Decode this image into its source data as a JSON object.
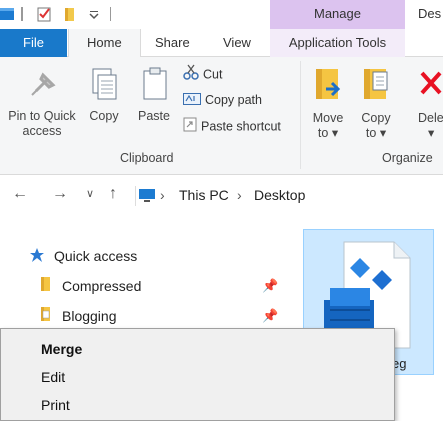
{
  "titlebar": {
    "manage_label": "Manage",
    "title_fragment": "Des"
  },
  "ribbon_tabs": {
    "file": "File",
    "home": "Home",
    "share": "Share",
    "view": "View",
    "application_tools": "Application Tools"
  },
  "clipboard": {
    "pin_label_1": "Pin to Quick",
    "pin_label_2": "access",
    "copy": "Copy",
    "paste": "Paste",
    "cut": "Cut",
    "copy_path": "Copy path",
    "paste_shortcut": "Paste shortcut",
    "group": "Clipboard"
  },
  "organize": {
    "move_to_1": "Move",
    "move_to_2": "to",
    "copy_to_1": "Copy",
    "copy_to_2": "to",
    "delete": "Dele",
    "group": "Organize"
  },
  "address": {
    "crumb_1": "This PC",
    "crumb_2": "Desktop"
  },
  "navpane": {
    "quick_access": "Quick access",
    "items": [
      {
        "label": "Compressed"
      },
      {
        "label": "Blogging"
      }
    ]
  },
  "files": {
    "selected_name_fragment": "eg"
  },
  "context_menu": {
    "items": [
      {
        "label": "Merge",
        "default": true
      },
      {
        "label": "Edit"
      },
      {
        "label": "Print"
      }
    ]
  },
  "colors": {
    "file_tab": "#1979ca",
    "manage_tab": "#dcc3ef",
    "selection": "#cce8ff",
    "delete_x": "#e81123"
  }
}
